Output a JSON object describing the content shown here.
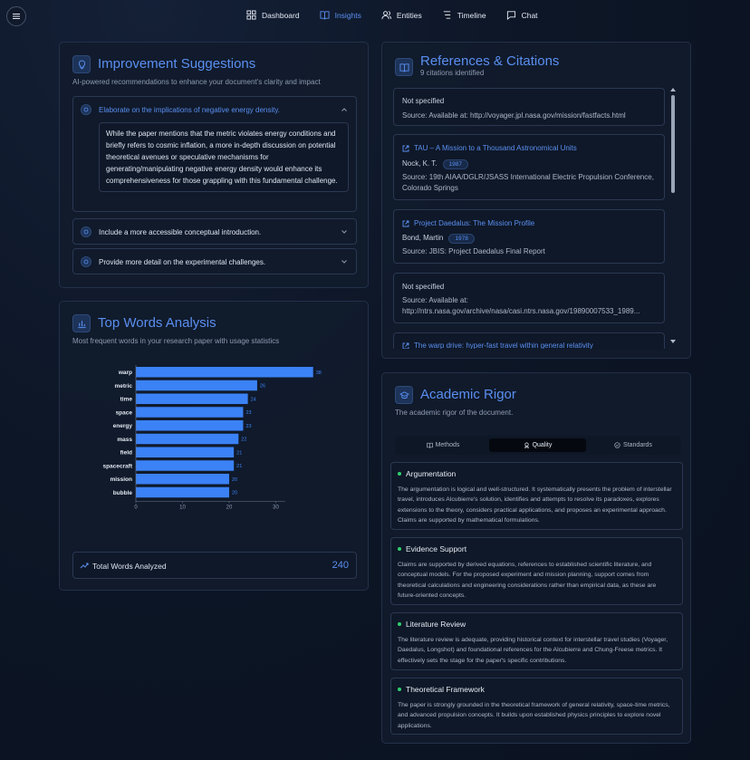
{
  "nav": {
    "items": [
      {
        "label": "Dashboard",
        "icon": "dashboard-icon",
        "active": false
      },
      {
        "label": "Insights",
        "icon": "book-icon",
        "active": true
      },
      {
        "label": "Entities",
        "icon": "users-icon",
        "active": false
      },
      {
        "label": "Timeline",
        "icon": "timeline-icon",
        "active": false
      },
      {
        "label": "Chat",
        "icon": "chat-icon",
        "active": false
      }
    ]
  },
  "improvement": {
    "title": "Improvement Suggestions",
    "subtitle": "AI-powered recommendations to enhance your document's clarity and impact",
    "items": [
      {
        "title": "Elaborate on the implications of negative energy density.",
        "expanded": true,
        "body": "While the paper mentions that the metric violates energy conditions and briefly refers to cosmic inflation, a more in-depth discussion on potential theoretical avenues or speculative mechanisms for generating/manipulating negative energy density would enhance its comprehensiveness for those grappling with this fundamental challenge."
      },
      {
        "title": "Include a more accessible conceptual introduction.",
        "expanded": false
      },
      {
        "title": "Provide more detail on the experimental challenges.",
        "expanded": false
      }
    ]
  },
  "top_words": {
    "title": "Top Words Analysis",
    "subtitle": "Most frequent words in your research paper with usage statistics",
    "total_label": "Total Words Analyzed",
    "total_value": "240"
  },
  "chart_data": {
    "type": "bar",
    "orientation": "horizontal",
    "categories": [
      "warp",
      "metric",
      "time",
      "space",
      "energy",
      "mass",
      "field",
      "spacecraft",
      "mission",
      "bubble"
    ],
    "values": [
      38,
      26,
      24,
      23,
      23,
      22,
      21,
      21,
      20,
      20
    ],
    "xlim": [
      0,
      38
    ],
    "xticks": [
      0,
      10,
      20,
      30
    ],
    "bar_color": "#3b82f6",
    "label_color": "#3b82f6"
  },
  "references": {
    "title": "References & Citations",
    "count_text": "9 citations identified",
    "items": [
      {
        "title": "Not specified",
        "link": false,
        "author": "",
        "year": "",
        "source": "Source: Available at: http://voyager.jpl.nasa.gov/mission/fastfacts.html"
      },
      {
        "title": "TAU – A Mission to a Thousand Astronomical Units",
        "link": true,
        "author": "Nock, K. T.",
        "year": "1987",
        "source": "Source: 19th AIAA/DGLR/JSASS International Electric Propulsion Conference, Colorado Springs"
      },
      {
        "title": "Project Daedalus: The Mission Profile",
        "link": true,
        "author": "Bond, Martin",
        "year": "1978",
        "source": "Source: JBIS: Project Daedalus Final Report"
      },
      {
        "title": "Not specified",
        "link": false,
        "author": "",
        "year": "",
        "source": "Source: Available at:",
        "source2": "http://ntrs.nasa.gov/archive/nasa/casi.ntrs.nasa.gov/19890007533_1989..."
      },
      {
        "title": "The warp drive: hyper-fast travel within general relativity",
        "link": true,
        "author": "",
        "year": "",
        "source": ""
      }
    ]
  },
  "rigor": {
    "title": "Academic Rigor",
    "subtitle": "The academic rigor of the document.",
    "tabs": [
      {
        "label": "Methods",
        "icon": "book-icon",
        "active": false
      },
      {
        "label": "Quality",
        "icon": "award-icon",
        "active": true
      },
      {
        "label": "Standards",
        "icon": "check-circle-icon",
        "active": false
      }
    ],
    "items": [
      {
        "title": "Argumentation",
        "text": "The argumentation is logical and well-structured. It systematically presents the problem of interstellar travel, introduces Alcubierre's solution, identifies and attempts to resolve its paradoxes, explores extensions to the theory, considers practical applications, and proposes an experimental approach. Claims are supported by mathematical formulations."
      },
      {
        "title": "Evidence Support",
        "text": "Claims are supported by derived equations, references to established scientific literature, and conceptual models. For the proposed experiment and mission planning, support comes from theoretical calculations and engineering considerations rather than empirical data, as these are future-oriented concepts."
      },
      {
        "title": "Literature Review",
        "text": "The literature review is adequate, providing historical context for interstellar travel studies (Voyager, Daedalus, Longshot) and foundational references for the Alcubierre and Chung-Freese metrics. It effectively sets the stage for the paper's specific contributions."
      },
      {
        "title": "Theoretical Framework",
        "text": "The paper is strongly grounded in the theoretical framework of general relativity, space-time metrics, and advanced propulsion concepts. It builds upon established physics principles to explore novel applications."
      }
    ]
  },
  "colors": {
    "accent": "#5a8ff0",
    "status_dot": "#2fcf6f",
    "background": "#0d1626"
  }
}
